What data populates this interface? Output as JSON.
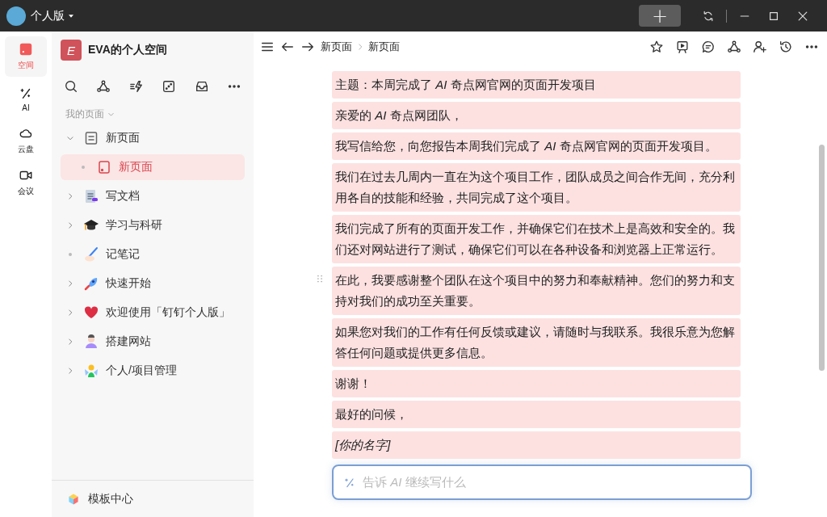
{
  "titlebar": {
    "edition": "个人版",
    "new_tab_button": "+"
  },
  "rail": [
    {
      "label": "空间",
      "selected": true
    },
    {
      "label": "AI",
      "selected": false
    },
    {
      "label": "云盘",
      "selected": false
    },
    {
      "label": "会议",
      "selected": false
    }
  ],
  "sidebar": {
    "space_badge": "E",
    "space_title": "EVA的个人空间",
    "section": "我的页面",
    "tree": [
      {
        "label": "新页面",
        "kind": "branch",
        "expanded": true,
        "selected": false,
        "children": [
          {
            "label": "新页面",
            "kind": "leaf",
            "selected": true
          }
        ]
      },
      {
        "label": "写文档",
        "kind": "branch",
        "expanded": false,
        "selected": false
      },
      {
        "label": "学习与科研",
        "kind": "branch",
        "expanded": false,
        "selected": false
      },
      {
        "label": "记笔记",
        "kind": "leaf",
        "selected": false
      },
      {
        "label": "快速开始",
        "kind": "branch",
        "expanded": false,
        "selected": false
      },
      {
        "label": "欢迎使用「钉钉个人版」",
        "kind": "branch",
        "expanded": false,
        "selected": false
      },
      {
        "label": "搭建网站",
        "kind": "branch",
        "expanded": false,
        "selected": false
      },
      {
        "label": "个人/项目管理",
        "kind": "branch",
        "expanded": false,
        "selected": false
      }
    ],
    "footer": "模板中心"
  },
  "breadcrumb": [
    "新页面",
    "新页面"
  ],
  "paragraphs": [
    {
      "text": "主题：本周完成了 *AI* 奇点网官网的页面开发项目",
      "italic": false,
      "handle": false
    },
    {
      "text": "亲爱的 *AI* 奇点网团队，",
      "italic": false,
      "handle": false
    },
    {
      "text": "我写信给您，向您报告本周我们完成了 *AI* 奇点网官网的页面开发项目。",
      "italic": false,
      "handle": false
    },
    {
      "text": "我们在过去几周内一直在为这个项目工作，团队成员之间合作无间，充分利用各自的技能和经验，共同完成了这个项目。",
      "italic": false,
      "handle": false
    },
    {
      "text": "我们完成了所有的页面开发工作，并确保它们在技术上是高效和安全的。我们还对网站进行了测试，确保它们可以在各种设备和浏览器上正常运行。",
      "italic": false,
      "handle": false
    },
    {
      "text": "在此，我要感谢整个团队在这个项目中的努力和奉献精神。您们的努力和支持对我们的成功至关重要。",
      "italic": false,
      "handle": true
    },
    {
      "text": "如果您对我们的工作有任何反馈或建议，请随时与我联系。我很乐意为您解答任何问题或提供更多信息。",
      "italic": false,
      "handle": false
    },
    {
      "text": "谢谢！",
      "italic": false,
      "handle": false
    },
    {
      "text": "最好的问候，",
      "italic": false,
      "handle": false
    },
    {
      "text": "[你的名字]",
      "italic": true,
      "handle": false
    }
  ],
  "ai_prompt": {
    "placeholder": "告诉 *AI* 继续写什么"
  }
}
